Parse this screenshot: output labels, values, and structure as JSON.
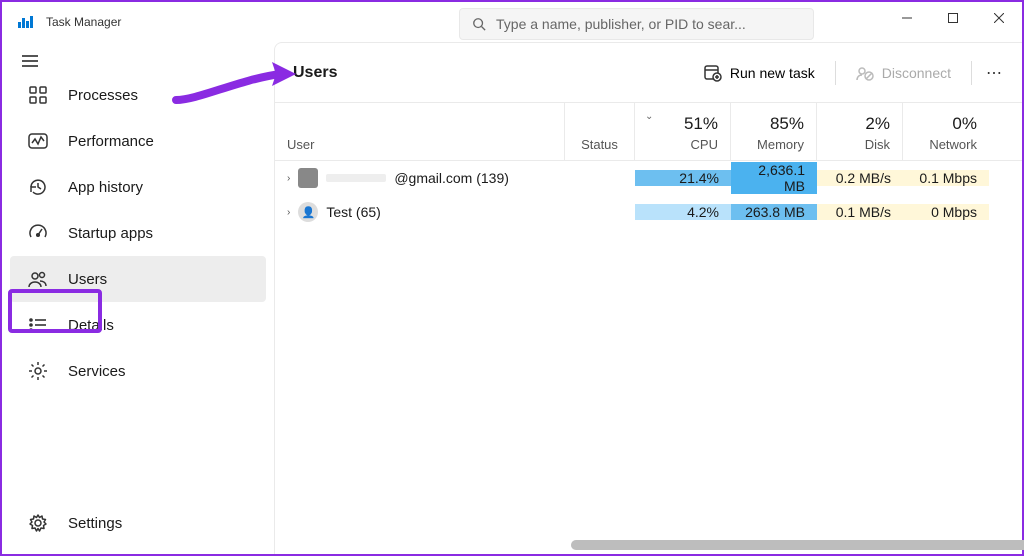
{
  "app": {
    "title": "Task Manager"
  },
  "search": {
    "placeholder": "Type a name, publisher, or PID to sear..."
  },
  "sidebar": {
    "items": [
      {
        "label": "Processes"
      },
      {
        "label": "Performance"
      },
      {
        "label": "App history"
      },
      {
        "label": "Startup apps"
      },
      {
        "label": "Users"
      },
      {
        "label": "Details"
      },
      {
        "label": "Services"
      }
    ],
    "settings_label": "Settings"
  },
  "page": {
    "heading": "Users",
    "run_new_task": "Run new task",
    "disconnect": "Disconnect"
  },
  "columns": {
    "user": "User",
    "status": "Status",
    "cpu": {
      "value": "51%",
      "label": "CPU"
    },
    "memory": {
      "value": "85%",
      "label": "Memory"
    },
    "disk": {
      "value": "2%",
      "label": "Disk"
    },
    "network": {
      "value": "0%",
      "label": "Network"
    }
  },
  "rows": [
    {
      "name": "@gmail.com (139)",
      "cpu": "21.4%",
      "memory": "2,636.1 MB",
      "disk": "0.2 MB/s",
      "network": "0.1 Mbps"
    },
    {
      "name": "Test (65)",
      "cpu": "4.2%",
      "memory": "263.8 MB",
      "disk": "0.1 MB/s",
      "network": "0 Mbps"
    }
  ]
}
